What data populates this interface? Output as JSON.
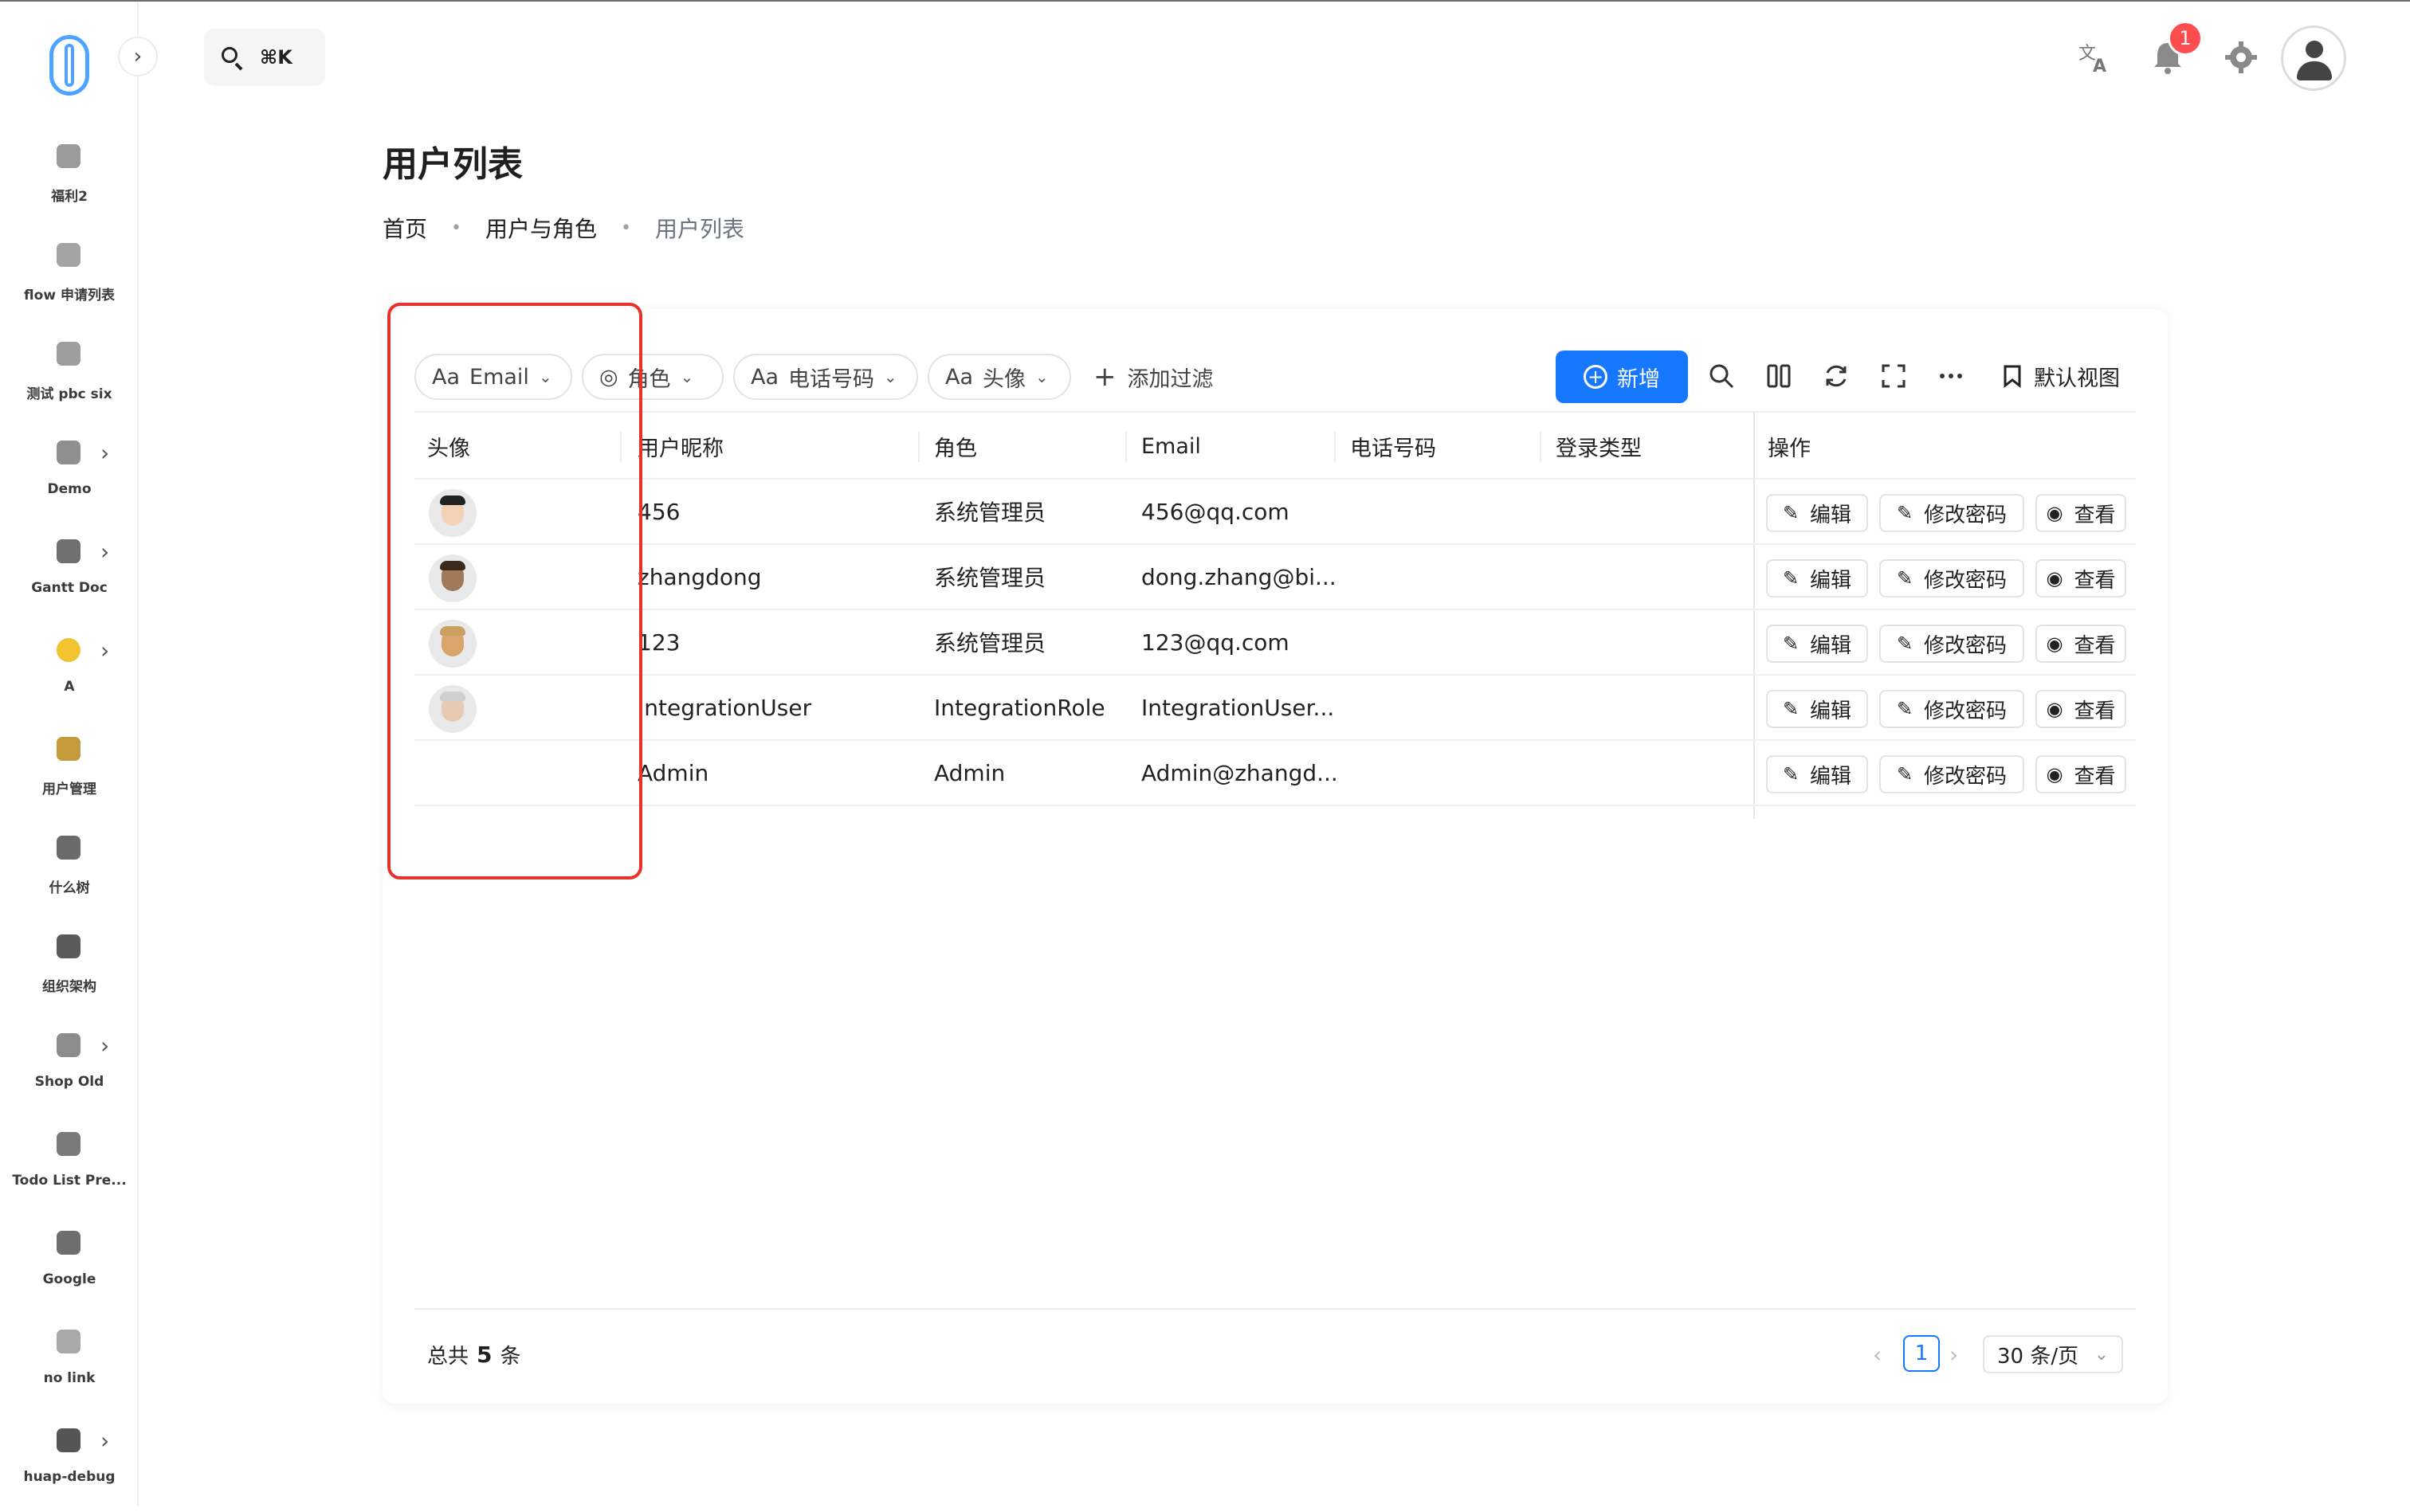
{
  "sidebar": {
    "items": [
      {
        "label": "福利2",
        "icon": "gift-bag-icon",
        "has_children": false
      },
      {
        "label": "flow 申请列表",
        "icon": "list-icon",
        "has_children": false
      },
      {
        "label": "测试 pbc six",
        "icon": "battery-icon",
        "has_children": false
      },
      {
        "label": "Demo",
        "icon": "clock-icon",
        "has_children": true
      },
      {
        "label": "Gantt Doc",
        "icon": "bar-chart-icon",
        "has_children": true
      },
      {
        "label": "A",
        "icon": "emoji-face-icon",
        "has_children": true
      },
      {
        "label": "用户管理",
        "icon": "people-icon",
        "has_children": false
      },
      {
        "label": "什么树",
        "icon": "tree-icon",
        "has_children": false
      },
      {
        "label": "组织架构",
        "icon": "org-chart-icon",
        "has_children": false
      },
      {
        "label": "Shop Old",
        "icon": "cart-icon",
        "has_children": true
      },
      {
        "label": "Todo List Pre...",
        "icon": "coffee-icon",
        "has_children": false
      },
      {
        "label": "Google",
        "icon": "globe-icon",
        "has_children": false
      },
      {
        "label": "no link",
        "icon": "folder-icon",
        "has_children": false
      },
      {
        "label": "huap-debug",
        "icon": "home-icon",
        "has_children": true
      }
    ]
  },
  "search": {
    "shortcut": "⌘K"
  },
  "header": {
    "notification_count": "1"
  },
  "page": {
    "title": "用户列表",
    "breadcrumb": [
      "首页",
      "用户与角色",
      "用户列表"
    ]
  },
  "toolbar": {
    "filters": [
      {
        "prefix": "Aa",
        "label": "Email"
      },
      {
        "prefix": "◎",
        "label": "角色"
      },
      {
        "prefix": "Aa",
        "label": "电话号码"
      },
      {
        "prefix": "Aa",
        "label": "头像"
      }
    ],
    "add_filter": "添加过滤",
    "new_button": "新增",
    "default_view": "默认视图"
  },
  "table": {
    "columns": [
      "头像",
      "用户昵称",
      "角色",
      "Email",
      "电话号码",
      "登录类型",
      "操作"
    ],
    "rows": [
      {
        "avatar": true,
        "nickname": "456",
        "role": "系统管理员",
        "email": "456@qq.com",
        "phone": "",
        "login_type": ""
      },
      {
        "avatar": true,
        "nickname": "zhangdong",
        "role": "系统管理员",
        "email": "dong.zhang@bi...",
        "phone": "",
        "login_type": ""
      },
      {
        "avatar": true,
        "nickname": "123",
        "role": "系统管理员",
        "email": "123@qq.com",
        "phone": "",
        "login_type": ""
      },
      {
        "avatar": true,
        "nickname": "IntegrationUser",
        "role": "IntegrationRole",
        "email": "IntegrationUser...",
        "phone": "",
        "login_type": ""
      },
      {
        "avatar": false,
        "nickname": "Admin",
        "role": "Admin",
        "email": "Admin@zhangd...",
        "phone": "",
        "login_type": ""
      }
    ],
    "actions": {
      "edit": "编辑",
      "change_password": "修改密码",
      "view": "查看"
    }
  },
  "footer": {
    "total_prefix": "总共",
    "total_count": "5",
    "total_suffix": "条",
    "current_page": "1",
    "page_size": "30 条/页"
  },
  "colors": {
    "accent": "#1677ff",
    "highlight": "#e8312a",
    "badge": "#ff4d4f"
  }
}
